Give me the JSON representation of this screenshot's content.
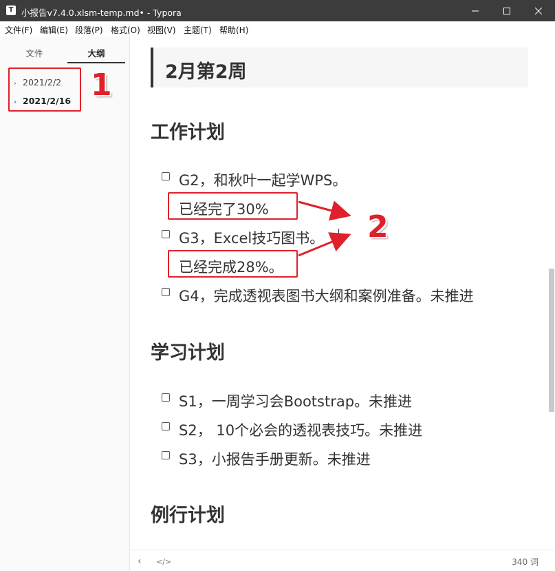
{
  "window": {
    "title": "小报告v7.4.0.xlsm-temp.md• - Typora",
    "app_icon": "T"
  },
  "menu": {
    "items": [
      "文件(F)",
      "编辑(E)",
      "段落(P)",
      "格式(O)",
      "视图(V)",
      "主题(T)",
      "帮助(H)"
    ]
  },
  "sidebar": {
    "tabs": [
      "文件",
      "大纲"
    ],
    "active_tab": "大纲",
    "outline": [
      {
        "label": "2021/2/2",
        "bold": false
      },
      {
        "label": "2021/2/16",
        "bold": true
      }
    ]
  },
  "annotations": {
    "one": "1",
    "two": "2",
    "color": "#e0202a"
  },
  "document": {
    "heading2": "2月第2周",
    "sections": [
      {
        "title": "工作计划",
        "tasks": [
          {
            "text": "G2，和秋叶一起学WPS。",
            "note": "已经完了30%"
          },
          {
            "text": "G3，Excel技巧图书。",
            "note": "已经完成28%。"
          },
          {
            "text": "G4，完成透视表图书大纲和案例准备。未推进"
          }
        ]
      },
      {
        "title": "学习计划",
        "tasks": [
          {
            "text": "S1，一周学习会Bootstrap。未推进"
          },
          {
            "text": "S2， 10个必会的透视表技巧。未推进"
          },
          {
            "text": "S3，小报告手册更新。未推进"
          }
        ]
      },
      {
        "title": "例行计划",
        "tasks": []
      }
    ]
  },
  "footer": {
    "word_count": "340 词",
    "icons": [
      "chevron-left-icon",
      "code-icon"
    ]
  },
  "colors": {
    "titlebar": "#3c3c3c",
    "accent_red": "#e0202a",
    "text": "#333333"
  }
}
